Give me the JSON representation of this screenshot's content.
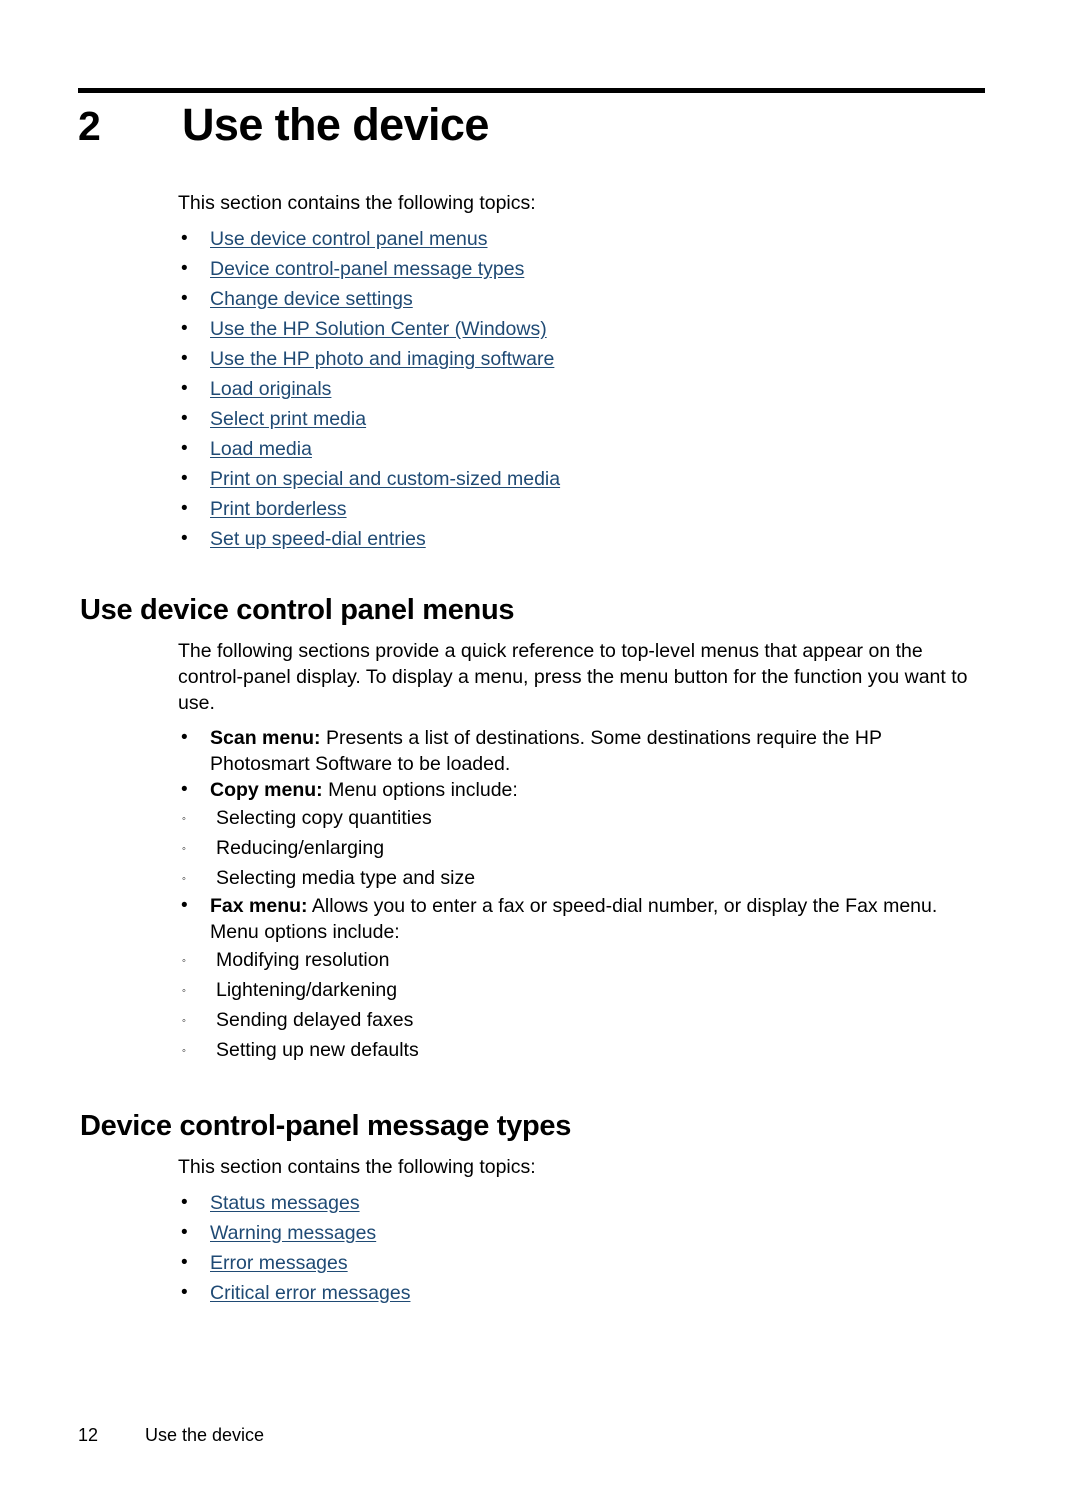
{
  "chapter": {
    "number": "2",
    "title": "Use the device"
  },
  "intro": {
    "lead": "This section contains the following topics:",
    "links": [
      "Use device control panel menus",
      "Device control-panel message types",
      "Change device settings",
      "Use the HP Solution Center (Windows)",
      "Use the HP photo and imaging software",
      "Load originals",
      "Select print media",
      "Load media",
      "Print on special and custom-sized media",
      "Print borderless",
      "Set up speed-dial entries"
    ]
  },
  "section_menus": {
    "heading": "Use device control panel menus",
    "paragraph": "The following sections provide a quick reference to top-level menus that appear on the control-panel display. To display a menu, press the menu button for the function you want to use.",
    "bullets": [
      {
        "label": "Scan menu:",
        "text": " Presents a list of destinations. Some destinations require the HP Photosmart Software to be loaded.",
        "subitems": []
      },
      {
        "label": "Copy menu:",
        "text": " Menu options include:",
        "subitems": [
          "Selecting copy quantities",
          "Reducing/enlarging",
          "Selecting media type and size"
        ]
      },
      {
        "label": "Fax menu:",
        "text": " Allows you to enter a fax or speed-dial number, or display the Fax menu. Menu options include:",
        "subitems": [
          "Modifying resolution",
          "Lightening/darkening",
          "Sending delayed faxes",
          "Setting up new defaults"
        ]
      }
    ]
  },
  "section_messages": {
    "heading": "Device control-panel message types",
    "lead": "This section contains the following topics:",
    "links": [
      "Status messages",
      "Warning messages",
      "Error messages",
      "Critical error messages"
    ]
  },
  "footer": {
    "page_number": "12",
    "title": "Use the device"
  },
  "colors": {
    "link": "#1f4a74",
    "text": "#000000",
    "background": "#ffffff"
  },
  "markers": {
    "bullet": "•",
    "subbullet": "◦"
  }
}
